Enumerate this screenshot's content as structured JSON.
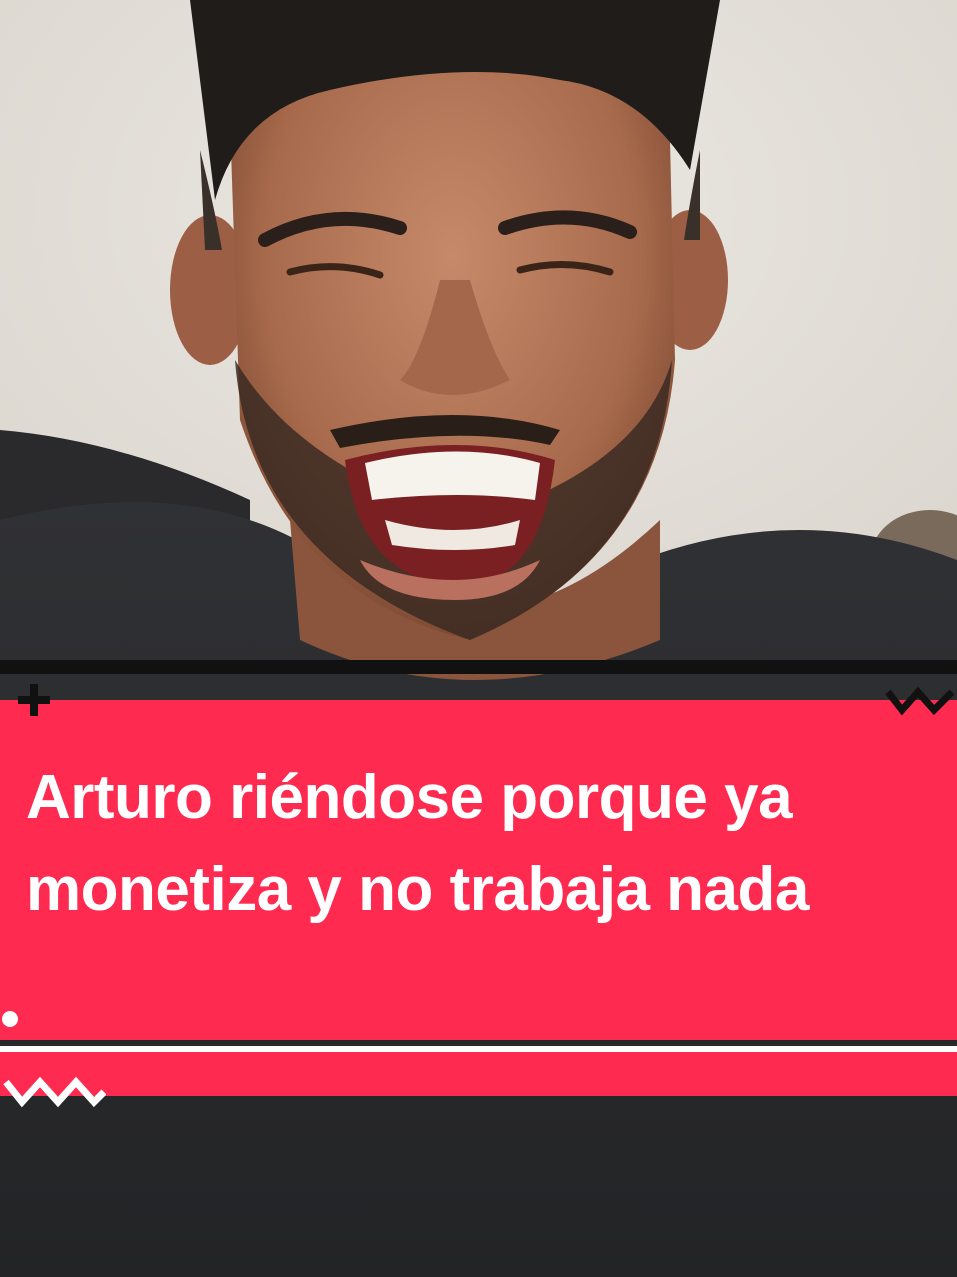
{
  "caption": {
    "text": "Arturo riéndose porque ya monetiza y no trabaja nada"
  },
  "colors": {
    "caption_background": "#fe2a50",
    "caption_text": "#ffffff",
    "wall": "#e4e0da",
    "shirt": "#2c2d2f"
  },
  "decorations": [
    "plus-icon",
    "zigzag-icon",
    "dot-icon",
    "zigzag-icon"
  ]
}
